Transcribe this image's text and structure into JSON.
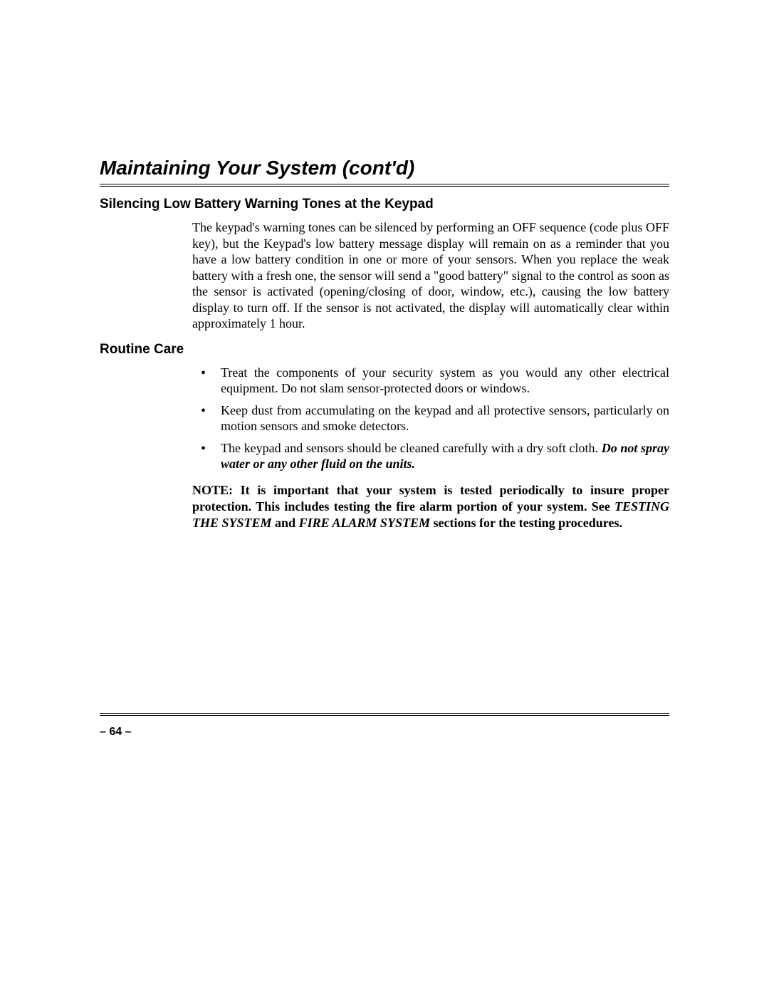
{
  "title": "Maintaining Your System (cont'd)",
  "section1": {
    "heading": "Silencing Low Battery Warning Tones at the Keypad",
    "para_a": "The keypad's warning tones can be silenced by performing an OFF sequence (code plus OFF key)",
    "para_b": ", but the Keypad's low battery message display will remain on as a reminder that you have a low battery condition in one or more of your sensors. When you replace the weak battery with a fresh one, the sensor will send a \"good battery\" signal to the control as soon as the sensor is activated (opening/closing of door, window, etc.), causing the low battery display to turn off. If the sensor is not activated, the display will automatically clear within approximately 1 hour."
  },
  "section2": {
    "heading": "Routine Care",
    "bullets": {
      "b1": "Treat the components of your security system as you would any other electrical equipment. Do not slam sensor-protected doors or windows.",
      "b2": "Keep dust from accumulating on the keypad and all protective sensors, particularly on motion sensors and smoke detectors.",
      "b3a": "The keypad and sensors should be cleaned carefully with a dry soft cloth.",
      "b3b": "Do not spray water or any other fluid on the units."
    }
  },
  "note": {
    "a": "NOTE: It is important that your system is tested periodically to insure proper protection. This includes testing the fire alarm portion of your system. See ",
    "ref1": "TESTING THE SYSTEM",
    "mid": " and ",
    "ref2": "FIRE ALARM SYSTEM",
    "b": " sections for the testing procedures."
  },
  "page_number": "– 64 –"
}
